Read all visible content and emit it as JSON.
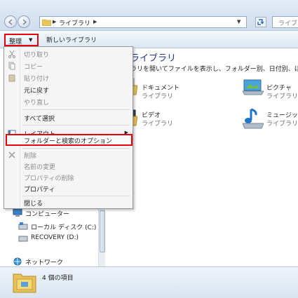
{
  "address_bar": {
    "path_label": "ライブラリ",
    "search_placeholder": "ライブラ"
  },
  "toolbar": {
    "organize_label": "整理",
    "new_library_label": "新しいライブラリ"
  },
  "library": {
    "title": "ライブラリ",
    "description": "ラリを開いてファイルを表示し、フォルダー別、日付別、ほ",
    "items": [
      {
        "name": "ドキュメント",
        "sub": "ライブラリ"
      },
      {
        "name": "ピクチャ",
        "sub": "ライブラリ"
      },
      {
        "name": "ビデオ",
        "sub": "ライブラリ"
      },
      {
        "name": "ミュージッ",
        "sub": "ライブラリ"
      }
    ]
  },
  "nav_tree": {
    "computer": "コンピューター",
    "local_disk": "ローカル ディスク (C:)",
    "recovery": "RECOVERY (D:)",
    "network": "ネットワーク"
  },
  "status": {
    "item_count": "4 個の項目"
  },
  "menu": {
    "cut": "切り取り",
    "copy": "コピー",
    "paste": "貼り付け",
    "undo": "元に戻す",
    "redo": "やり直し",
    "select_all": "すべて選択",
    "layout": "レイアウト",
    "folder_options": "フォルダーと検索のオプション",
    "delete": "削除",
    "rename": "名前の変更",
    "remove_properties": "プロパティの削除",
    "properties": "プロパティ",
    "close": "閉じる"
  },
  "colors": {
    "highlight_border": "#e3000b",
    "title_blue": "#1e3287",
    "disabled_text": "#8d8d8d"
  },
  "icons": [
    "back-arrow-icon",
    "forward-arrow-icon",
    "folder-icon",
    "refresh-icon",
    "documents-library-icon",
    "pictures-library-icon",
    "videos-library-icon",
    "music-library-icon",
    "computer-icon",
    "drive-icon",
    "network-icon",
    "cut-icon",
    "paste-icon",
    "layout-icon",
    "delete-icon"
  ]
}
